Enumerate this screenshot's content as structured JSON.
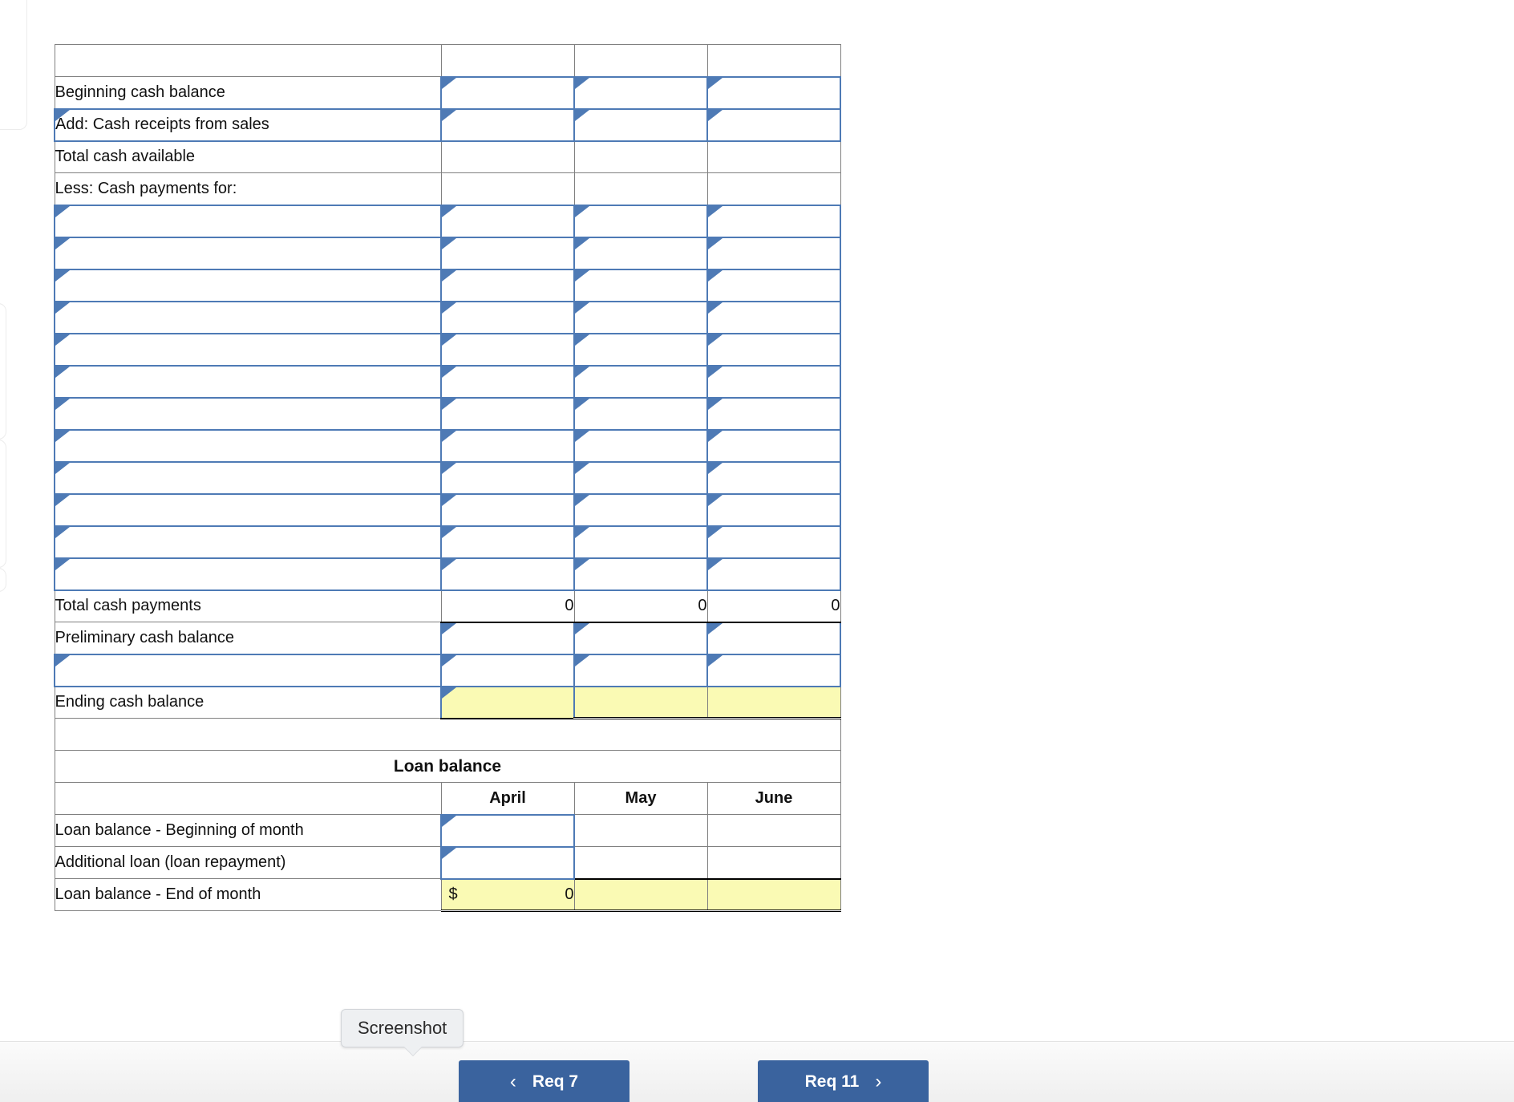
{
  "worksheet": {
    "months": [
      "April",
      "May",
      "June"
    ],
    "cash_budget": {
      "rows": [
        {
          "label": "Beginning cash balance",
          "kind": "input"
        },
        {
          "label": "Add: Cash receipts from sales",
          "kind": "input"
        },
        {
          "label": "Total cash available",
          "kind": "plain"
        },
        {
          "label": "Less: Cash payments for:",
          "kind": "plain"
        },
        {
          "label": "",
          "kind": "input"
        },
        {
          "label": "",
          "kind": "input"
        },
        {
          "label": "",
          "kind": "input"
        },
        {
          "label": "",
          "kind": "input"
        },
        {
          "label": "",
          "kind": "input"
        },
        {
          "label": "",
          "kind": "input"
        },
        {
          "label": "",
          "kind": "input"
        },
        {
          "label": "",
          "kind": "input"
        },
        {
          "label": "",
          "kind": "input"
        },
        {
          "label": "",
          "kind": "input"
        },
        {
          "label": "",
          "kind": "input"
        },
        {
          "label": "",
          "kind": "input"
        },
        {
          "label": "Total cash payments",
          "kind": "total",
          "values": [
            "0",
            "0",
            "0"
          ]
        },
        {
          "label": "Preliminary cash balance",
          "kind": "input"
        },
        {
          "label": "",
          "kind": "input"
        },
        {
          "label": "Ending cash balance",
          "kind": "answer",
          "values": [
            "",
            "",
            ""
          ]
        }
      ]
    },
    "loan_balance": {
      "title": "Loan balance",
      "rows": [
        {
          "label": "Loan balance - Beginning of month",
          "kind": "input"
        },
        {
          "label": "Additional loan (loan repayment)",
          "kind": "input"
        },
        {
          "label": "Loan balance - End of month",
          "kind": "answer",
          "currency": "$",
          "values": [
            "0",
            "",
            ""
          ]
        }
      ]
    }
  },
  "tooltip": {
    "text": "Screenshot"
  },
  "bottom_nav": {
    "prev_label": "Req 7",
    "prev_chevron": "‹",
    "next_label": "Req 11",
    "next_chevron": "›"
  },
  "colors": {
    "header_blue": "#8CAEDD",
    "input_border": "#4E7AB5",
    "answer_yellow": "#FAFAB4",
    "button_blue": "#3A639E"
  }
}
